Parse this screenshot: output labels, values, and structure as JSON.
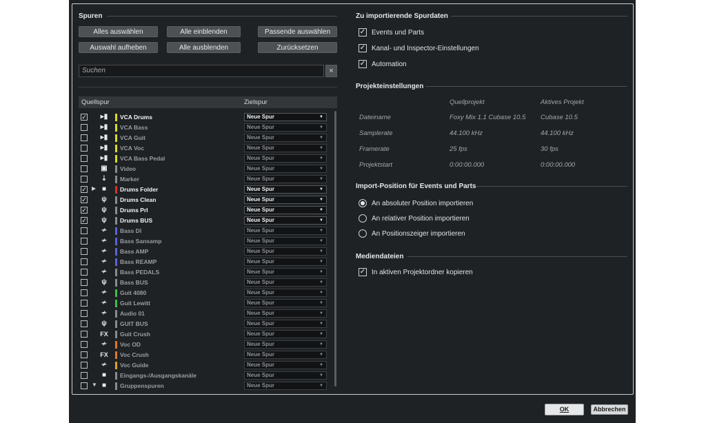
{
  "tracks_panel": {
    "title": "Spuren",
    "buttons": {
      "select_all": "Alles auswählen",
      "show_all": "Alle einblenden",
      "select_matching": "Passende auswählen",
      "deselect": "Auswahl aufheben",
      "hide_all": "Alle ausblenden",
      "reset": "Zurücksetzen"
    },
    "search_placeholder": "Suchen",
    "search_clear": "×",
    "columns": {
      "source": "Quellspur",
      "target": "Zielspur"
    },
    "rows": [
      {
        "name": "VCA Drums",
        "checked": true,
        "active": true,
        "icon": "vca-icon",
        "color": "#d7dc2a",
        "target": "Neue Spur"
      },
      {
        "name": "VCA Bass",
        "checked": false,
        "active": false,
        "icon": "vca-icon",
        "color": "#d7dc2a",
        "target": "Neue Spur"
      },
      {
        "name": "VCA Guit",
        "checked": false,
        "active": false,
        "icon": "vca-icon",
        "color": "#d7dc2a",
        "target": "Neue Spur"
      },
      {
        "name": "VCA Voc",
        "checked": false,
        "active": false,
        "icon": "vca-icon",
        "color": "#d7dc2a",
        "target": "Neue Spur"
      },
      {
        "name": "VCA Bass Pedal",
        "checked": false,
        "active": false,
        "icon": "vca-icon",
        "color": "#d7dc2a",
        "target": "Neue Spur"
      },
      {
        "name": "Video",
        "checked": false,
        "active": false,
        "icon": "video-icon",
        "color": "#8a8d90",
        "target": "Neue Spur"
      },
      {
        "name": "Marker",
        "checked": false,
        "active": false,
        "icon": "marker-icon",
        "color": "#8a8d90",
        "target": "Neue Spur"
      },
      {
        "name": "Drums Folder",
        "checked": true,
        "active": true,
        "icon": "folder-icon",
        "color": "#d8322a",
        "target": "Neue Spur",
        "arrow": "▶"
      },
      {
        "name": "Drums Clean",
        "checked": true,
        "active": true,
        "icon": "group-icon",
        "color": "#8a8d90",
        "target": "Neue Spur"
      },
      {
        "name": "Drums Prl",
        "checked": true,
        "active": true,
        "icon": "group-icon",
        "color": "#8a8d90",
        "target": "Neue Spur"
      },
      {
        "name": "Drums BUS",
        "checked": true,
        "active": true,
        "icon": "group-icon",
        "color": "#8a8d90",
        "target": "Neue Spur"
      },
      {
        "name": "Bass DI",
        "checked": false,
        "active": false,
        "icon": "audio-icon",
        "color": "#5a63d8",
        "target": "Neue Spur"
      },
      {
        "name": "Bass Sansamp",
        "checked": false,
        "active": false,
        "icon": "audio-icon",
        "color": "#5a63d8",
        "target": "Neue Spur"
      },
      {
        "name": "Bass AMP",
        "checked": false,
        "active": false,
        "icon": "audio-icon",
        "color": "#5a63d8",
        "target": "Neue Spur"
      },
      {
        "name": "Bass REAMP",
        "checked": false,
        "active": false,
        "icon": "audio-icon",
        "color": "#5a63d8",
        "target": "Neue Spur"
      },
      {
        "name": "Bass PEDALS",
        "checked": false,
        "active": false,
        "icon": "audio-icon",
        "color": "#8a8d90",
        "target": "Neue Spur"
      },
      {
        "name": "Bass BUS",
        "checked": false,
        "active": false,
        "icon": "group-icon",
        "color": "#8a8d90",
        "target": "Neue Spur"
      },
      {
        "name": "Guit 4080",
        "checked": false,
        "active": false,
        "icon": "audio-icon",
        "color": "#3fbf4a",
        "target": "Neue Spur"
      },
      {
        "name": "Guit Lewitt",
        "checked": false,
        "active": false,
        "icon": "audio-icon",
        "color": "#3fbf4a",
        "target": "Neue Spur"
      },
      {
        "name": "Audio 01",
        "checked": false,
        "active": false,
        "icon": "audio-icon",
        "color": "#8a8d90",
        "target": "Neue Spur"
      },
      {
        "name": "GUIT BUS",
        "checked": false,
        "active": false,
        "icon": "group-icon",
        "color": "#8a8d90",
        "target": "Neue Spur"
      },
      {
        "name": "Guit Crush",
        "checked": false,
        "active": false,
        "icon": "fx-icon",
        "color": "#8a8d90",
        "target": "Neue Spur"
      },
      {
        "name": "Voc OD",
        "checked": false,
        "active": false,
        "icon": "audio-icon",
        "color": "#e0772a",
        "target": "Neue Spur"
      },
      {
        "name": "Voc Crush",
        "checked": false,
        "active": false,
        "icon": "fx-icon",
        "color": "#e0772a",
        "target": "Neue Spur"
      },
      {
        "name": "Voc Guide",
        "checked": false,
        "active": false,
        "icon": "audio-icon",
        "color": "#e0a22a",
        "target": "Neue Spur"
      },
      {
        "name": "Eingangs-/Ausgangskanäle",
        "checked": false,
        "active": false,
        "icon": "folder-icon",
        "color": "#8a8d90",
        "target": "Neue Spur"
      },
      {
        "name": "Gruppenspuren",
        "checked": false,
        "active": false,
        "icon": "folder-icon",
        "color": "#8a8d90",
        "target": "Neue Spur",
        "arrow": "▼"
      }
    ]
  },
  "import_data": {
    "title": "Zu importierende Spurdaten",
    "options": [
      {
        "label": "Events und Parts",
        "checked": true
      },
      {
        "label": "Kanal- und Inspector-Einstellungen",
        "checked": true
      },
      {
        "label": "Automation",
        "checked": true
      }
    ]
  },
  "project_settings": {
    "title": "Projekteinstellungen",
    "col_source": "Quellprojekt",
    "col_active": "Aktives Projekt",
    "rows": [
      {
        "label": "Dateiname",
        "source": "Foxy Mix 1.1 Cubase 10.5",
        "active": "Cubase 10.5"
      },
      {
        "label": "Samplerate",
        "source": "44.100 kHz",
        "active": "44.100 kHz"
      },
      {
        "label": "Framerate",
        "source": "25 fps",
        "active": "30 fps"
      },
      {
        "label": "Projektstart",
        "source": "0:00:00.000",
        "active": "0:00:00.000"
      }
    ]
  },
  "import_position": {
    "title": "Import-Position für Events und Parts",
    "options": [
      {
        "label": "An absoluter Position importieren",
        "selected": true
      },
      {
        "label": "An relativer Position importieren",
        "selected": false
      },
      {
        "label": "An Positionszeiger importieren",
        "selected": false
      }
    ]
  },
  "media": {
    "title": "Mediendateien",
    "copy_label": "In aktiven Projektordner kopieren",
    "copy_checked": true
  },
  "footer": {
    "ok": "OK",
    "cancel": "Abbrechen"
  }
}
